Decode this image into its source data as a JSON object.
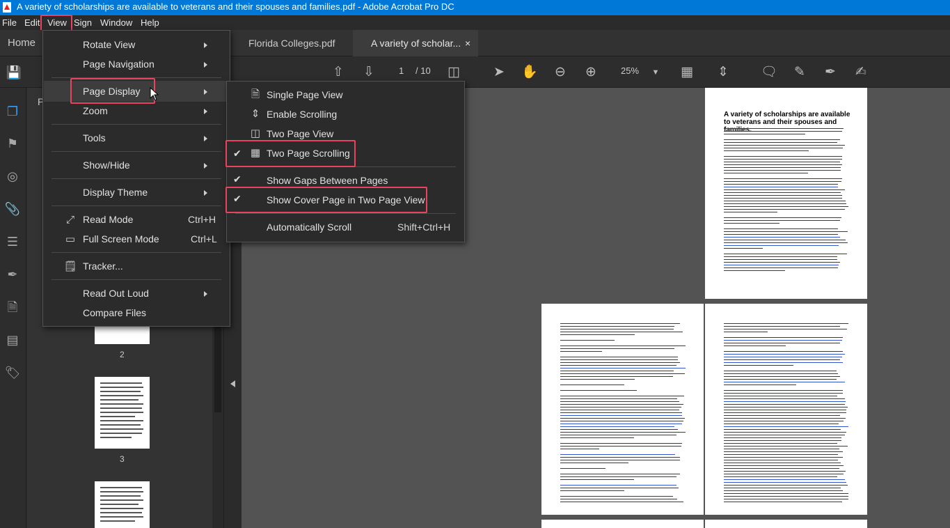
{
  "window": {
    "title": "A variety of scholarships are available to veterans and their spouses and families.pdf - Adobe Acrobat Pro DC"
  },
  "menubar": {
    "items": [
      "File",
      "Edit",
      "View",
      "Sign",
      "Window",
      "Help"
    ]
  },
  "tabs": {
    "home": "Home",
    "tab1": "Florida Colleges.pdf",
    "tab2": "A variety of scholar...",
    "close": "×"
  },
  "toolbar": {
    "page_current": "1",
    "page_total": "/ 10",
    "zoom": "25%"
  },
  "thumbnails": {
    "labels": [
      "2",
      "3"
    ],
    "panel_initial": "P"
  },
  "view_menu": {
    "rotate_view": "Rotate View",
    "page_navigation": "Page Navigation",
    "page_display": "Page Display",
    "zoom": "Zoom",
    "tools": "Tools",
    "show_hide": "Show/Hide",
    "display_theme": "Display Theme",
    "read_mode": "Read Mode",
    "read_mode_shortcut": "Ctrl+H",
    "full_screen": "Full Screen Mode",
    "full_screen_shortcut": "Ctrl+L",
    "tracker": "Tracker...",
    "read_out_loud": "Read Out Loud",
    "compare_files": "Compare Files"
  },
  "page_display_menu": {
    "single_page_view": "Single Page View",
    "enable_scrolling": "Enable Scrolling",
    "two_page_view": "Two Page View",
    "two_page_scrolling": "Two Page Scrolling",
    "show_gaps": "Show Gaps Between Pages",
    "show_cover": "Show Cover Page in Two Page View",
    "auto_scroll": "Automatically Scroll",
    "auto_scroll_shortcut": "Shift+Ctrl+H"
  },
  "document": {
    "page1_title": "A variety of scholarships are available to veterans and their spouses and families."
  },
  "colors": {
    "highlight": "#e8435f",
    "titlebar": "#0078d7",
    "hand_tool": "#3d9ae8"
  }
}
